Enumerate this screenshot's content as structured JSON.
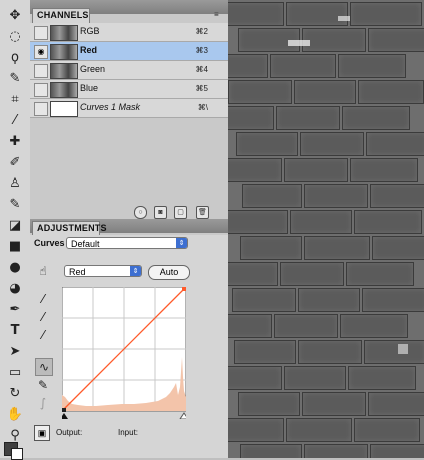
{
  "channels_panel": {
    "tab_label": "CHANNELS",
    "rows": [
      {
        "name": "RGB",
        "shortcut": "⌘2"
      },
      {
        "name": "Red",
        "shortcut": "⌘3"
      },
      {
        "name": "Green",
        "shortcut": "⌘4"
      },
      {
        "name": "Blue",
        "shortcut": "⌘5"
      },
      {
        "name": "Curves 1 Mask",
        "shortcut": "⌘\\"
      }
    ]
  },
  "adjustments_panel": {
    "tab_label": "ADJUSTMENTS",
    "curves_label": "Curves",
    "preset_value": "Default",
    "channel_value": "Red",
    "auto_label": "Auto",
    "output_label": "Output:",
    "input_label": "Input:"
  },
  "icons": {
    "tools": [
      "move-tool-icon",
      "marquee-tool-icon",
      "lasso-tool-icon",
      "quick-select-tool-icon",
      "crop-tool-icon",
      "eyedropper-tool-icon",
      "healing-brush-tool-icon",
      "brush-tool-icon",
      "clone-stamp-tool-icon",
      "history-brush-tool-icon",
      "eraser-tool-icon",
      "gradient-tool-icon",
      "blur-tool-icon",
      "dodge-tool-icon",
      "pen-tool-icon",
      "type-tool-icon",
      "path-select-tool-icon",
      "shape-tool-icon",
      "3d-rotate-tool-icon",
      "3d-orbit-tool-icon",
      "hand-tool-icon",
      "zoom-tool-icon"
    ]
  },
  "curve": {
    "input_points": [
      0,
      255
    ],
    "output_points": [
      0,
      255
    ]
  }
}
